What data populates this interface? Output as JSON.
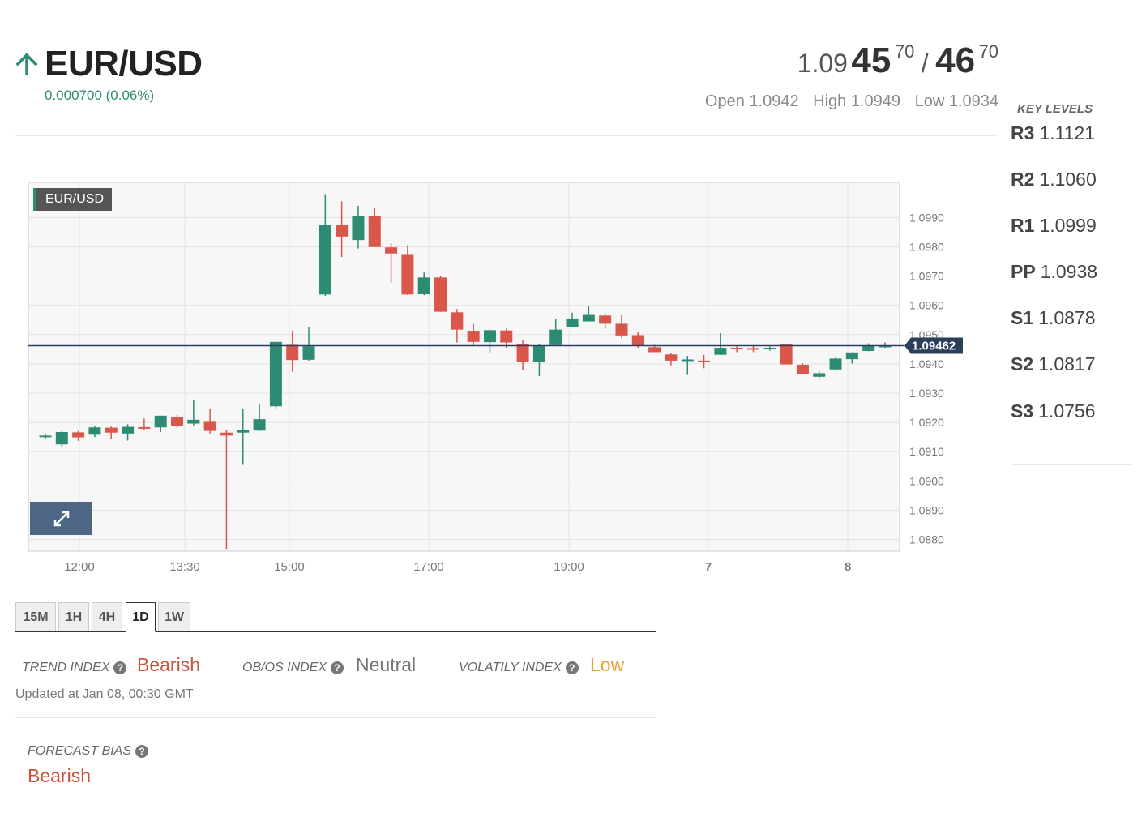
{
  "header": {
    "arrow_icon": "arrow-up-icon",
    "pair": "EUR/USD",
    "change": "0.000700 (0.06%)",
    "quote": {
      "bid_prefix": "1.09",
      "bid_big": "45",
      "bid_pip": "70",
      "separator": "/",
      "ask_big": "46",
      "ask_pip": "70"
    },
    "ohl": {
      "open": "Open 1.0942",
      "high": "High 1.0949",
      "low": "Low 1.0934"
    }
  },
  "chart": {
    "legend": "EUR/USD",
    "expand_icon": "expand-icon",
    "current_price_label": "1.09462",
    "colors": {
      "up": "#2e8b73",
      "down": "#d9574a",
      "line": "#2b3e5c"
    }
  },
  "chart_data": {
    "type": "candlestick",
    "x_ticks": [
      "12:00",
      "13:30",
      "15:00",
      "17:00",
      "19:00",
      "7",
      "8"
    ],
    "y_ticks": [
      "1.0990",
      "1.0980",
      "1.0970",
      "1.0960",
      "1.0950",
      "1.0940",
      "1.0930",
      "1.0920",
      "1.0910",
      "1.0900",
      "1.0890",
      "1.0880"
    ],
    "ylim": [
      1.0876,
      1.1002
    ],
    "current_price": 1.09462,
    "candles": [
      [
        1.09151,
        1.09159,
        1.09143,
        1.09155
      ],
      [
        1.09125,
        1.0917,
        1.09115,
        1.09167
      ],
      [
        1.09166,
        1.09171,
        1.09137,
        1.09149
      ],
      [
        1.09158,
        1.09187,
        1.0915,
        1.09183
      ],
      [
        1.09182,
        1.09186,
        1.09143,
        1.09165
      ],
      [
        1.09162,
        1.09194,
        1.09138,
        1.09185
      ],
      [
        1.09184,
        1.09213,
        1.09173,
        1.09183
      ],
      [
        1.09183,
        1.09216,
        1.09167,
        1.09223
      ],
      [
        1.09218,
        1.09226,
        1.09181,
        1.09189
      ],
      [
        1.09196,
        1.09277,
        1.0919,
        1.09209
      ],
      [
        1.09202,
        1.09246,
        1.09162,
        1.09171
      ],
      [
        1.09165,
        1.09175,
        1.08768,
        1.09155
      ],
      [
        1.09165,
        1.09245,
        1.09055,
        1.09174
      ],
      [
        1.09172,
        1.09265,
        1.0917,
        1.09211
      ],
      [
        1.09255,
        1.09369,
        1.09248,
        1.09475
      ],
      [
        1.09465,
        1.09513,
        1.09373,
        1.09413
      ],
      [
        1.09414,
        1.09526,
        1.09411,
        1.0946
      ],
      [
        1.09637,
        1.0998,
        1.09632,
        1.09875
      ],
      [
        1.09875,
        1.09955,
        1.09765,
        1.09835
      ],
      [
        1.09823,
        1.0994,
        1.09794,
        1.09905
      ],
      [
        1.09905,
        1.09932,
        1.09818,
        1.09799
      ],
      [
        1.09798,
        1.09812,
        1.09677,
        1.09777
      ],
      [
        1.09775,
        1.09805,
        1.09635,
        1.09637
      ],
      [
        1.09638,
        1.09712,
        1.09635,
        1.09695
      ],
      [
        1.09695,
        1.097,
        1.09578,
        1.09578
      ],
      [
        1.09576,
        1.09587,
        1.09473,
        1.09517
      ],
      [
        1.09513,
        1.09537,
        1.0946,
        1.09475
      ],
      [
        1.09474,
        1.09518,
        1.09438,
        1.09515
      ],
      [
        1.09514,
        1.0952,
        1.09455,
        1.09473
      ],
      [
        1.09468,
        1.0948,
        1.09378,
        1.09408
      ],
      [
        1.09408,
        1.09469,
        1.09358,
        1.09462
      ],
      [
        1.09464,
        1.09554,
        1.09463,
        1.09517
      ],
      [
        1.09527,
        1.09575,
        1.09527,
        1.09555
      ],
      [
        1.09545,
        1.09596,
        1.09545,
        1.09567
      ],
      [
        1.09565,
        1.09572,
        1.0952,
        1.09537
      ],
      [
        1.09537,
        1.09566,
        1.09488,
        1.09497
      ],
      [
        1.09498,
        1.09509,
        1.09455,
        1.09462
      ],
      [
        1.09457,
        1.09465,
        1.0944,
        1.0944
      ],
      [
        1.09432,
        1.09437,
        1.09395,
        1.09411
      ],
      [
        1.09415,
        1.09427,
        1.09362,
        1.09415
      ],
      [
        1.09411,
        1.09431,
        1.09385,
        1.0941
      ],
      [
        1.09431,
        1.09505,
        1.09431,
        1.09455
      ],
      [
        1.09455,
        1.0946,
        1.0944,
        1.0945
      ],
      [
        1.09454,
        1.09464,
        1.0944,
        1.09449
      ],
      [
        1.09452,
        1.09459,
        1.09445,
        1.09455
      ],
      [
        1.09468,
        1.09469,
        1.09398,
        1.09398
      ],
      [
        1.09397,
        1.09402,
        1.09364,
        1.09364
      ],
      [
        1.09356,
        1.09374,
        1.09351,
        1.09368
      ],
      [
        1.09381,
        1.09425,
        1.09377,
        1.09418
      ],
      [
        1.09416,
        1.09439,
        1.09401,
        1.09439
      ],
      [
        1.09444,
        1.0947,
        1.09443,
        1.09463
      ],
      [
        1.0946,
        1.09473,
        1.09455,
        1.09462
      ]
    ]
  },
  "tabs": [
    {
      "label": "15M",
      "active": false
    },
    {
      "label": "1H",
      "active": false
    },
    {
      "label": "4H",
      "active": false
    },
    {
      "label": "1D",
      "active": true
    },
    {
      "label": "1W",
      "active": false
    }
  ],
  "indices": {
    "trend_label": "TREND INDEX",
    "trend_value": "Bearish",
    "obos_label": "OB/OS INDEX",
    "obos_value": "Neutral",
    "vol_label": "VOLATILY INDEX",
    "vol_value": "Low",
    "help_icon": "question-circle-icon",
    "help_glyph": "?",
    "updated": "Updated at Jan 08, 00:30 GMT",
    "colors": {
      "bearish": "#c9553e",
      "neutral": "#777777",
      "low": "#e8a13a"
    }
  },
  "forecast": {
    "label": "FORECAST BIAS",
    "value": "Bearish"
  },
  "key_levels": {
    "title": "KEY LEVELS",
    "levels": [
      {
        "name": "R3",
        "value": "1.1121"
      },
      {
        "name": "R2",
        "value": "1.1060"
      },
      {
        "name": "R1",
        "value": "1.0999"
      },
      {
        "name": "PP",
        "value": "1.0938"
      },
      {
        "name": "S1",
        "value": "1.0878"
      },
      {
        "name": "S2",
        "value": "1.0817"
      },
      {
        "name": "S3",
        "value": "1.0756"
      }
    ]
  }
}
